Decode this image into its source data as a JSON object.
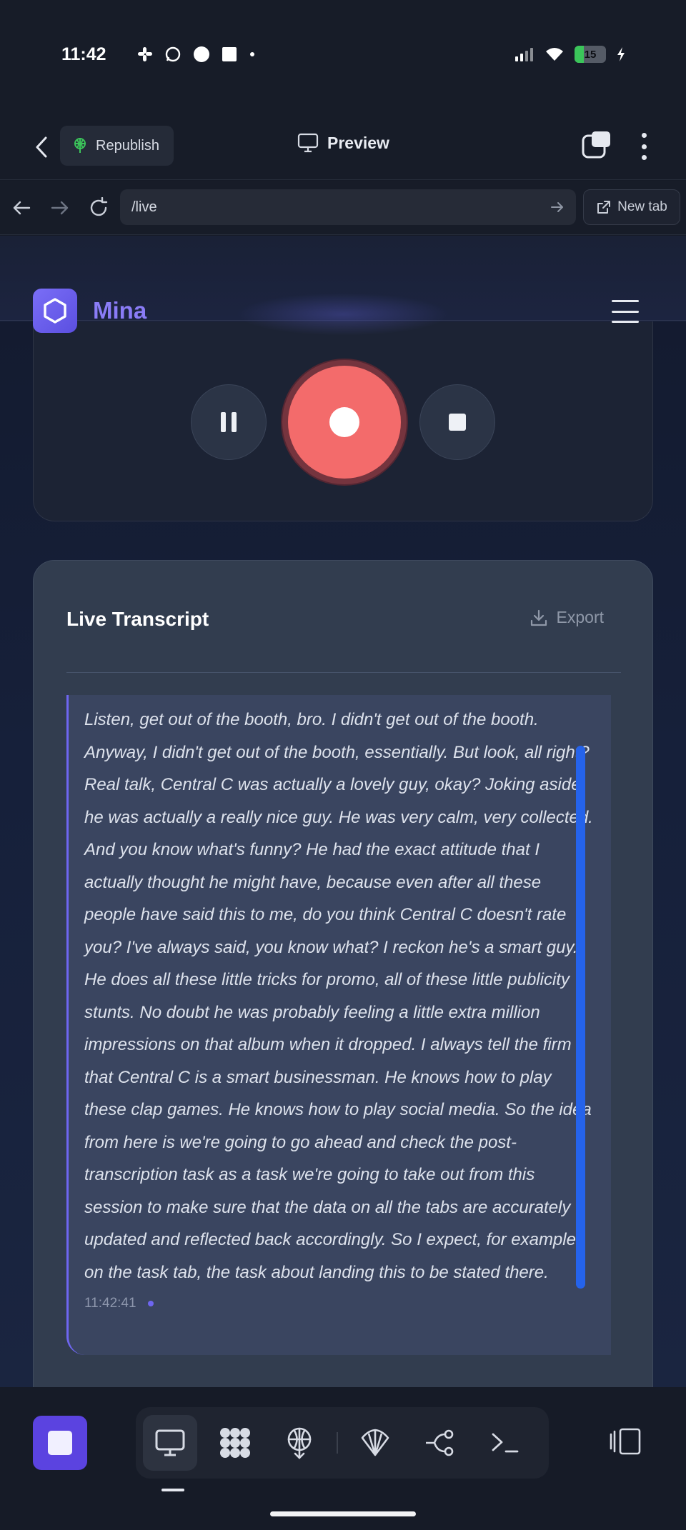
{
  "status_bar": {
    "time": "11:42",
    "battery": "15"
  },
  "top_bar": {
    "republish_label": "Republish",
    "preview_label": "Preview"
  },
  "url_bar": {
    "url": "/live",
    "new_tab_label": "New tab"
  },
  "app": {
    "brand": "Mina",
    "transcript": {
      "title": "Live Transcript",
      "export_label": "Export",
      "segments": [
        {
          "text": "Listen, get out of the booth, bro. I didn't get out of the booth. Anyway, I didn't get out of the booth, essentially. But look, all right? Real talk, Central C was actually a lovely guy, okay? Joking aside, he was actually a really nice guy. He was very calm, very collected. And you know what's funny? He had the exact attitude that I actually thought he might have, because even after all these people have said this to me, do you think Central C doesn't rate you? I've always said, you know what? I reckon he's a smart guy. He does all these little tricks for promo, all of these little publicity stunts. No doubt he was probably feeling a little extra million impressions on that album when it dropped. I always tell the firm that Central C is a smart businessman. He knows how to play these clap games. He knows how to play social media. So the idea from here is we're going to go ahead and check the post-transcription task as a task we're going to take out from this session to make sure that the data on all the tabs are accurately updated and reflected back accordingly. So I expect, for example, on the task tab, the task about landing this to be stated there.",
          "timestamp": "11:42:41"
        }
      ]
    }
  },
  "colors": {
    "accent": "#6e66f0",
    "record": "#f36b6b",
    "scrollbar": "#2563eb",
    "republish_icon": "#3bc55a"
  }
}
